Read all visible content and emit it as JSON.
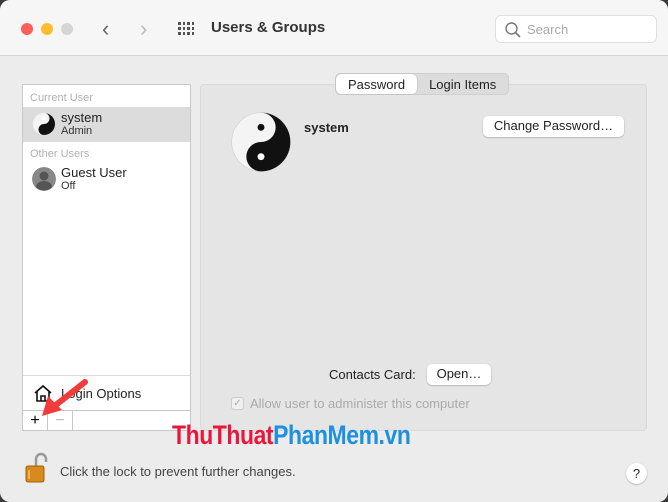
{
  "window": {
    "title": "Users & Groups",
    "search_placeholder": "Search"
  },
  "sidebar": {
    "current_user_header": "Current User",
    "current_user": {
      "name": "system",
      "role": "Admin"
    },
    "other_users_header": "Other Users",
    "other_users": [
      {
        "name": "Guest User",
        "status": "Off"
      }
    ],
    "login_options": "Login Options",
    "add_label": "+",
    "remove_label": "−"
  },
  "tabs": [
    {
      "label": "Password",
      "active": true
    },
    {
      "label": "Login Items",
      "active": false
    }
  ],
  "main": {
    "user_name": "system",
    "change_password": "Change Password…",
    "contacts_card_label": "Contacts Card:",
    "open_button": "Open…",
    "allow_admin_label": "Allow user to administer this computer",
    "allow_admin_checked": true,
    "allow_admin_disabled": true
  },
  "footer": {
    "lock_text": "Click the lock to prevent further changes.",
    "help": "?"
  },
  "watermark": {
    "part1": "ThuThuat",
    "part2": "PhanMem.vn",
    "color1": "#e8173c",
    "color2": "#1e90e0"
  },
  "colors": {
    "close": "#fe5f57",
    "minimize": "#febc2e",
    "zoom_disabled": "#d5d5d5",
    "arrow": "#f23b3b"
  }
}
